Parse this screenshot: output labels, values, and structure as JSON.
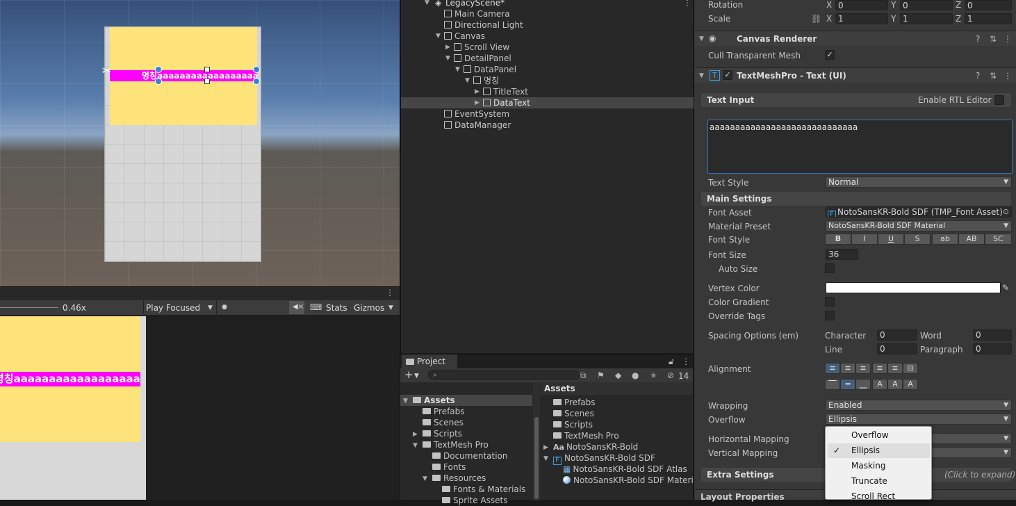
{
  "scene": {
    "magenta_text": "명칭aaaaaaaaaaaaaaaaaaa..."
  },
  "game_toolbar": {
    "scale": "0.46x",
    "play_mode": "Play Focused",
    "stats": "Stats",
    "gizmos": "Gizmos"
  },
  "game": {
    "magenta_text": "명칭aaaaaaaaaaaaaaaaaa..."
  },
  "hierarchy": {
    "scene_name": "LegacyScene*",
    "items": [
      {
        "label": "Main Camera"
      },
      {
        "label": "Directional Light"
      },
      {
        "label": "Canvas"
      },
      {
        "label": "Scroll View"
      },
      {
        "label": "DetailPanel"
      },
      {
        "label": "DataPanel"
      },
      {
        "label": "명칭"
      },
      {
        "label": "TitleText"
      },
      {
        "label": "DataText"
      },
      {
        "label": "EventSystem"
      },
      {
        "label": "DataManager"
      }
    ]
  },
  "project": {
    "tab": "Project",
    "hidden_count": "14",
    "tree": [
      {
        "label": "Assets"
      },
      {
        "label": "Prefabs"
      },
      {
        "label": "Scenes"
      },
      {
        "label": "Scripts"
      },
      {
        "label": "TextMesh Pro"
      },
      {
        "label": "Documentation"
      },
      {
        "label": "Fonts"
      },
      {
        "label": "Resources"
      },
      {
        "label": "Fonts & Materials"
      },
      {
        "label": "Sprite Assets"
      }
    ],
    "assets_header": "Assets",
    "assets": [
      {
        "label": "Prefabs"
      },
      {
        "label": "Scenes"
      },
      {
        "label": "Scripts"
      },
      {
        "label": "TextMesh Pro"
      },
      {
        "label": "NotoSansKR-Bold"
      },
      {
        "label": "NotoSansKR-Bold SDF"
      },
      {
        "label": "NotoSansKR-Bold SDF Atlas"
      },
      {
        "label": "NotoSansKR-Bold SDF Material"
      }
    ]
  },
  "inspector": {
    "rotation_label": "Rotation",
    "scale_label": "Scale",
    "rot": {
      "x": "0",
      "y": "0",
      "z": "0"
    },
    "scale": {
      "x": "1",
      "y": "1",
      "z": "1"
    },
    "axis": {
      "x": "X",
      "y": "Y",
      "z": "Z"
    },
    "canvas_renderer": "Canvas Renderer",
    "cull_label": "Cull Transparent Mesh",
    "tmp_title": "TextMeshPro - Text (UI)",
    "text_input_label": "Text Input",
    "rtl_label": "Enable RTL Editor",
    "text_value": "aaaaaaaaaaaaaaaaaaaaaaaaaaaaa",
    "text_style_label": "Text Style",
    "text_style_value": "Normal",
    "main_settings": "Main Settings",
    "font_asset_label": "Font Asset",
    "font_asset_value": "NotoSansKR-Bold SDF (TMP_Font Asset)",
    "material_preset_label": "Material Preset",
    "material_preset_value": "NotoSansKR-Bold SDF Material",
    "font_style_label": "Font Style",
    "font_style_buttons": [
      "B",
      "I",
      "U",
      "S",
      "ab",
      "AB",
      "SC"
    ],
    "font_size_label": "Font Size",
    "font_size_value": "36",
    "auto_size_label": "Auto Size",
    "vertex_color_label": "Vertex Color",
    "color_gradient_label": "Color Gradient",
    "override_tags_label": "Override Tags",
    "spacing_label": "Spacing Options (em)",
    "character_label": "Character",
    "character_value": "0",
    "word_label": "Word",
    "word_value": "0",
    "line_label": "Line",
    "line_value": "0",
    "paragraph_label": "Paragraph",
    "paragraph_value": "0",
    "alignment_label": "Alignment",
    "wrapping_label": "Wrapping",
    "wrapping_value": "Enabled",
    "overflow_label": "Overflow",
    "overflow_value": "Ellipsis",
    "hmap_label": "Horizontal Mapping",
    "vmap_label": "Vertical Mapping",
    "extra_settings": "Extra Settings",
    "click_expand": "(Click to expand)",
    "layout_properties": "Layout Properties"
  },
  "overflow_menu": {
    "options": [
      "Overflow",
      "Ellipsis",
      "Masking",
      "Truncate",
      "Scroll Rect"
    ],
    "selected": "Ellipsis",
    "check": "✓"
  }
}
